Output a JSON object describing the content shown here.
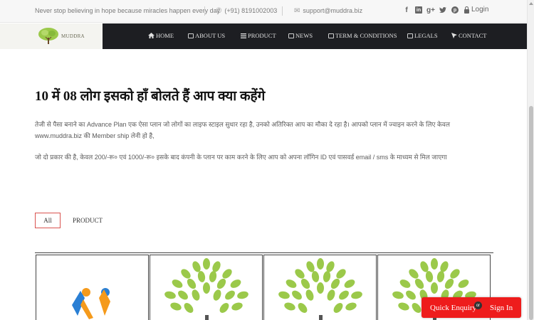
{
  "topbar": {
    "tagline": "Never stop believing in hope because miracles happen every day",
    "phone": "(+91) 8191002003",
    "email": "support@muddra.biz",
    "social_icons": [
      "facebook-icon",
      "linkedin-icon",
      "google-plus-icon",
      "twitter-icon",
      "pinterest-icon"
    ],
    "login_label": "Login"
  },
  "logo": {
    "text": "MUDDRA"
  },
  "nav": {
    "items": [
      {
        "label": "HOME",
        "icon": "home-icon"
      },
      {
        "label": "ABOUT US",
        "icon": "card-icon"
      },
      {
        "label": "PRODUCT",
        "icon": "list-icon"
      },
      {
        "label": "NEWS",
        "icon": "card-icon"
      },
      {
        "label": "TERM & CONDITIONS",
        "icon": "card-icon"
      },
      {
        "label": "LEGALS",
        "icon": "card-icon"
      },
      {
        "label": "CONTACT",
        "icon": "cursor-icon"
      }
    ]
  },
  "main": {
    "heading": "10 में 08 लोग इसको हाँ बोलते हैं आप क्या कहेंगे",
    "paragraph1": "तेजी से पैसा बनाने का Advance Plan एक ऐसा प्लान जो लोगों का लाइफ स्टाइल सुधार रहा है, उनको अतिरिक्त आप का मौका दे रहा है। आपको प्लान में ज्वाइन करने के लिए केवल www.muddra.biz की Member ship लेनी हो है,",
    "paragraph2": "जो दो प्रकार की है, केवल 200/-रू० एवं 1000/-रू० इसके बाद कंपनी के प्लान पर काम करने के लिए आप को अपना लॉगिन ID एवं पासवर्ड email / sms के माध्यम से मिल जाएगा",
    "filters": {
      "all": "All",
      "product": "PRODUCT"
    }
  },
  "widget": {
    "enquiry": "Quick Enquiry",
    "or": "or",
    "signin": "Sign In"
  },
  "colors": {
    "accent": "#ee1c1c",
    "nav_bg": "#1d1e22",
    "leaf": "#9bc94a"
  }
}
